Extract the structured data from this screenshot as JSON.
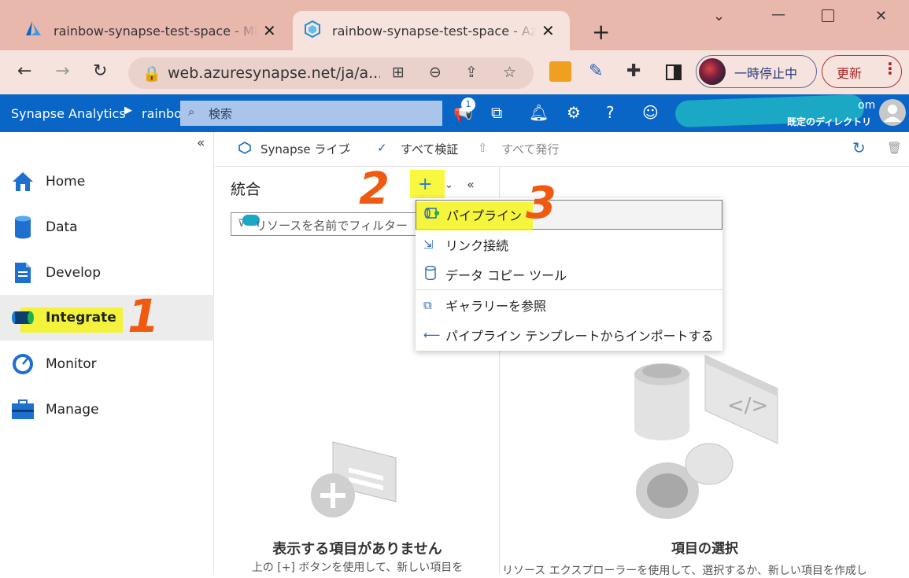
{
  "browser": {
    "tabs": [
      {
        "title": "rainbow-synapse-test-space - Mi",
        "icon": "azure-logo-icon"
      },
      {
        "title": "rainbow-synapse-test-space - Azu",
        "icon": "synapse-icon",
        "active": true
      }
    ],
    "new_tab": "+",
    "url": "web.azuresynapse.net/ja/a...",
    "pause_label": "一時停止中",
    "update_label": "更新"
  },
  "azure_header": {
    "brand": "Synapse Analytics",
    "breadcrumb": "rainbow",
    "search_placeholder": "検索",
    "notification_count": "1",
    "account_suffix": "om",
    "directory": "既定のディレクトリ"
  },
  "sidebar": {
    "collapse": "«",
    "items": [
      {
        "label": "Home",
        "icon": "home-icon"
      },
      {
        "label": "Data",
        "icon": "data-icon"
      },
      {
        "label": "Develop",
        "icon": "develop-icon"
      },
      {
        "label": "Integrate",
        "icon": "integrate-icon",
        "active": true
      },
      {
        "label": "Monitor",
        "icon": "monitor-icon"
      },
      {
        "label": "Manage",
        "icon": "manage-icon"
      }
    ]
  },
  "toolbar": {
    "live_label": "Synapse ライブ",
    "validate_all": "すべて検証",
    "publish_all": "すべて発行"
  },
  "resource_pane": {
    "title": "統合",
    "filter_placeholder": "リソースを名前でフィルター",
    "empty_title": "表示する項目がありません",
    "empty_subtitle": "上の [+] ボタンを使用して、新しい項目を"
  },
  "main": {
    "select_title": "項目の選択",
    "select_subtitle": "リソース エクスプローラーを使用して、選択するか、新しい項目を作成し"
  },
  "dropdown": {
    "items": [
      {
        "label": "パイプライン",
        "icon": "pipeline-icon"
      },
      {
        "label": "リンク接続",
        "icon": "link-connection-icon"
      },
      {
        "label": "データ コピー ツール",
        "icon": "copy-data-icon"
      },
      {
        "label": "ギャラリーを参照",
        "icon": "gallery-icon"
      },
      {
        "label": "パイプライン テンプレートからインポートする",
        "icon": "import-icon"
      }
    ]
  },
  "annotations": {
    "step1": "1",
    "step2": "2",
    "step3": "3"
  },
  "colors": {
    "azure_blue": "#0a66c6",
    "highlight": "#f5f500",
    "annotation": "#f05a10"
  }
}
